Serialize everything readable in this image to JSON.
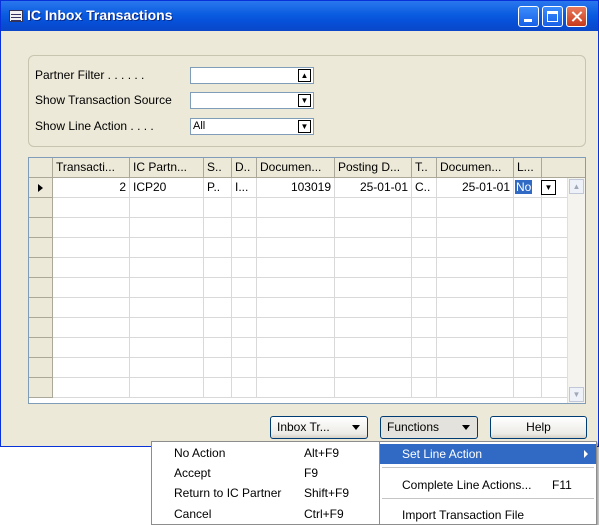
{
  "window": {
    "title": "IC Inbox Transactions"
  },
  "filters": {
    "partner_filter_label": "Partner Filter . . . . . .",
    "partner_filter_value": "",
    "show_source_label": "Show Transaction Source",
    "show_source_value": "",
    "show_line_action_label": "Show Line Action . . . .",
    "show_line_action_value": "All"
  },
  "table": {
    "columns": [
      "Transacti...",
      "IC Partn...",
      "S..",
      "D..",
      "Documen...",
      "Posting D...",
      "T..",
      "Documen...",
      "L..."
    ],
    "rows": [
      {
        "transaction_no": "2",
        "ic_partner": "ICP20",
        "source": "P..",
        "doc_type": "I...",
        "document_no": "103019",
        "posting_date": "25-01-01",
        "transaction_type": "C..",
        "document_date": "25-01-01",
        "line_action": "No"
      }
    ]
  },
  "buttons": {
    "inbox": "Inbox Tr...",
    "functions": "Functions",
    "help": "Help"
  },
  "menu_left": {
    "items": [
      {
        "label": "No Action",
        "shortcut": "Alt+F9"
      },
      {
        "label": "Accept",
        "shortcut": "F9"
      },
      {
        "label": "Return to IC Partner",
        "shortcut": "Shift+F9"
      },
      {
        "label": "Cancel",
        "shortcut": "Ctrl+F9"
      }
    ]
  },
  "menu_right": {
    "items": [
      {
        "label": "Set Line Action",
        "shortcut": ""
      },
      {
        "label": "Complete Line Actions...",
        "shortcut": "F11"
      },
      {
        "label": "Import Transaction File",
        "shortcut": ""
      }
    ]
  },
  "colors": {
    "title_bar": "#0a5ce0",
    "selection": "#316ac5",
    "window_bg": "#ece9d8"
  }
}
